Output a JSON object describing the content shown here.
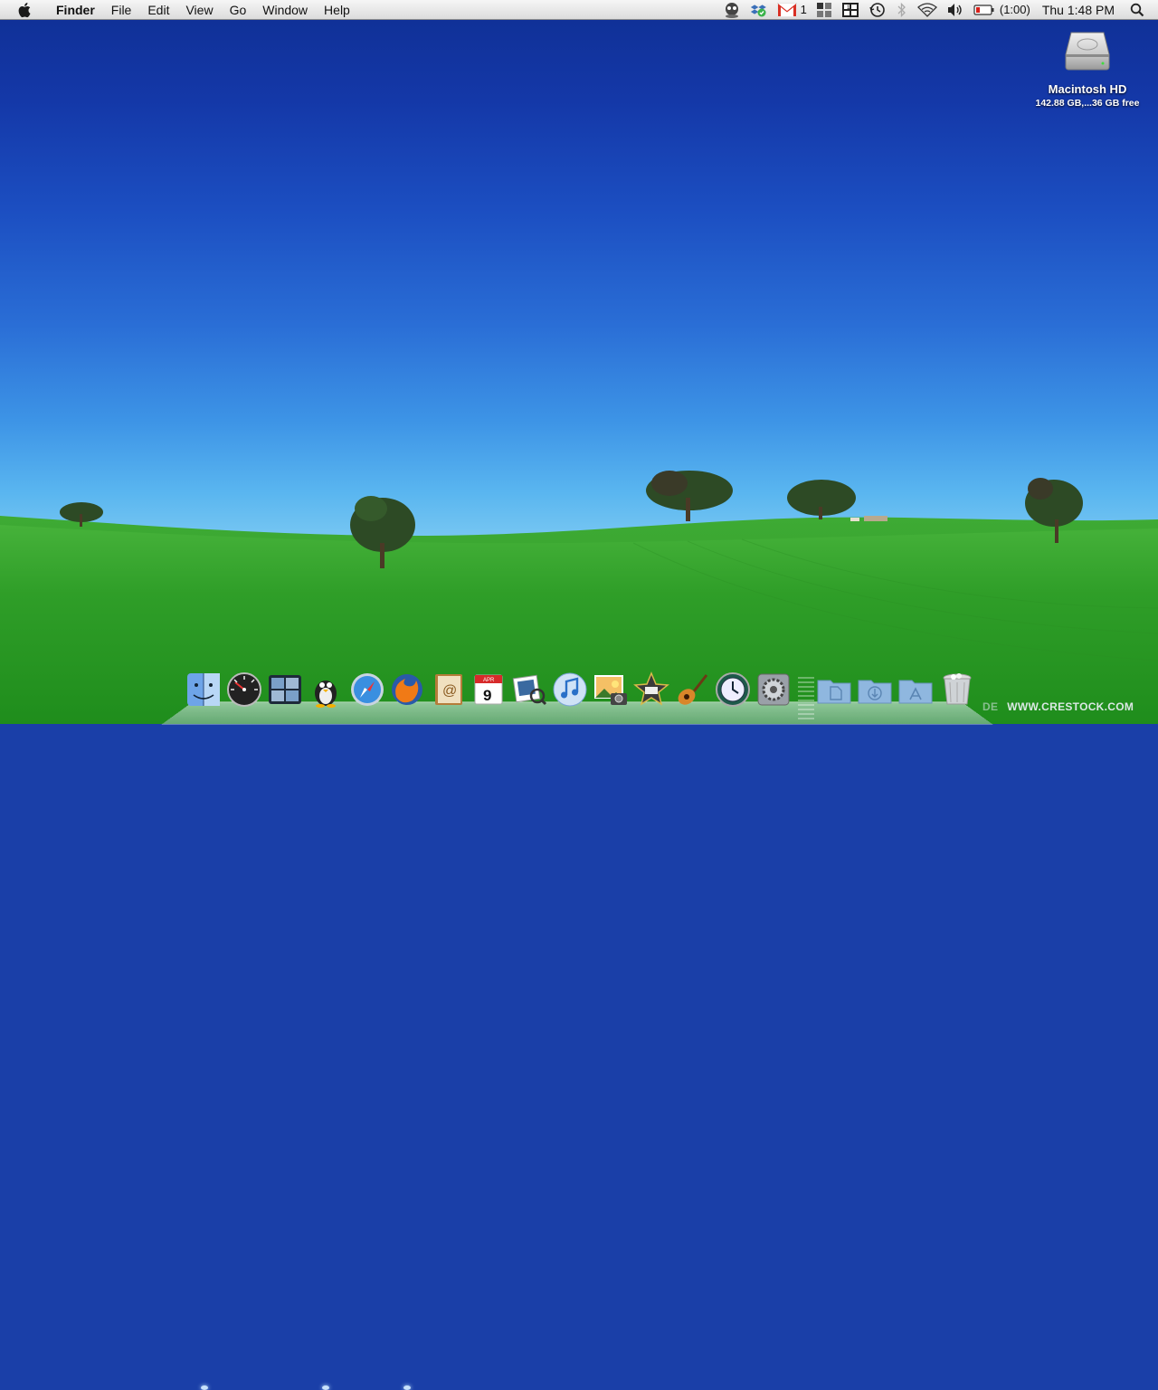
{
  "menubar": {
    "apple_icon": "apple-logo",
    "app_name": "Finder",
    "menus": [
      "File",
      "Edit",
      "View",
      "Go",
      "Window",
      "Help"
    ],
    "status": {
      "gmail_count": "1",
      "battery_time": "(1:00)",
      "clock": "Thu 1:48 PM"
    }
  },
  "desktop": {
    "drive_icon": {
      "name": "Macintosh HD",
      "info": "142.88 GB,...36 GB free"
    }
  },
  "dock": {
    "apps": [
      "finder-icon",
      "dashboard-icon",
      "spaces-icon",
      "adium-icon",
      "safari-icon",
      "firefox-icon",
      "address-book-icon",
      "ical-icon",
      "preview-icon",
      "itunes-icon",
      "iphoto-icon",
      "imovie-icon",
      "garageband-icon",
      "time-machine-icon",
      "system-preferences-icon"
    ],
    "ical_date": "9",
    "ical_month": "APR",
    "stacks": [
      "documents-folder-icon",
      "downloads-folder-icon",
      "applications-folder-icon",
      "trash-icon"
    ]
  },
  "watermark": {
    "partial": "DE",
    "text": "WWW.CRESTOCK.COM"
  },
  "colors": {
    "sky_top": "#0f2f94",
    "sky_horizon": "#86cff3",
    "grass": "#2fa52a",
    "gmail_red": "#d93025"
  }
}
